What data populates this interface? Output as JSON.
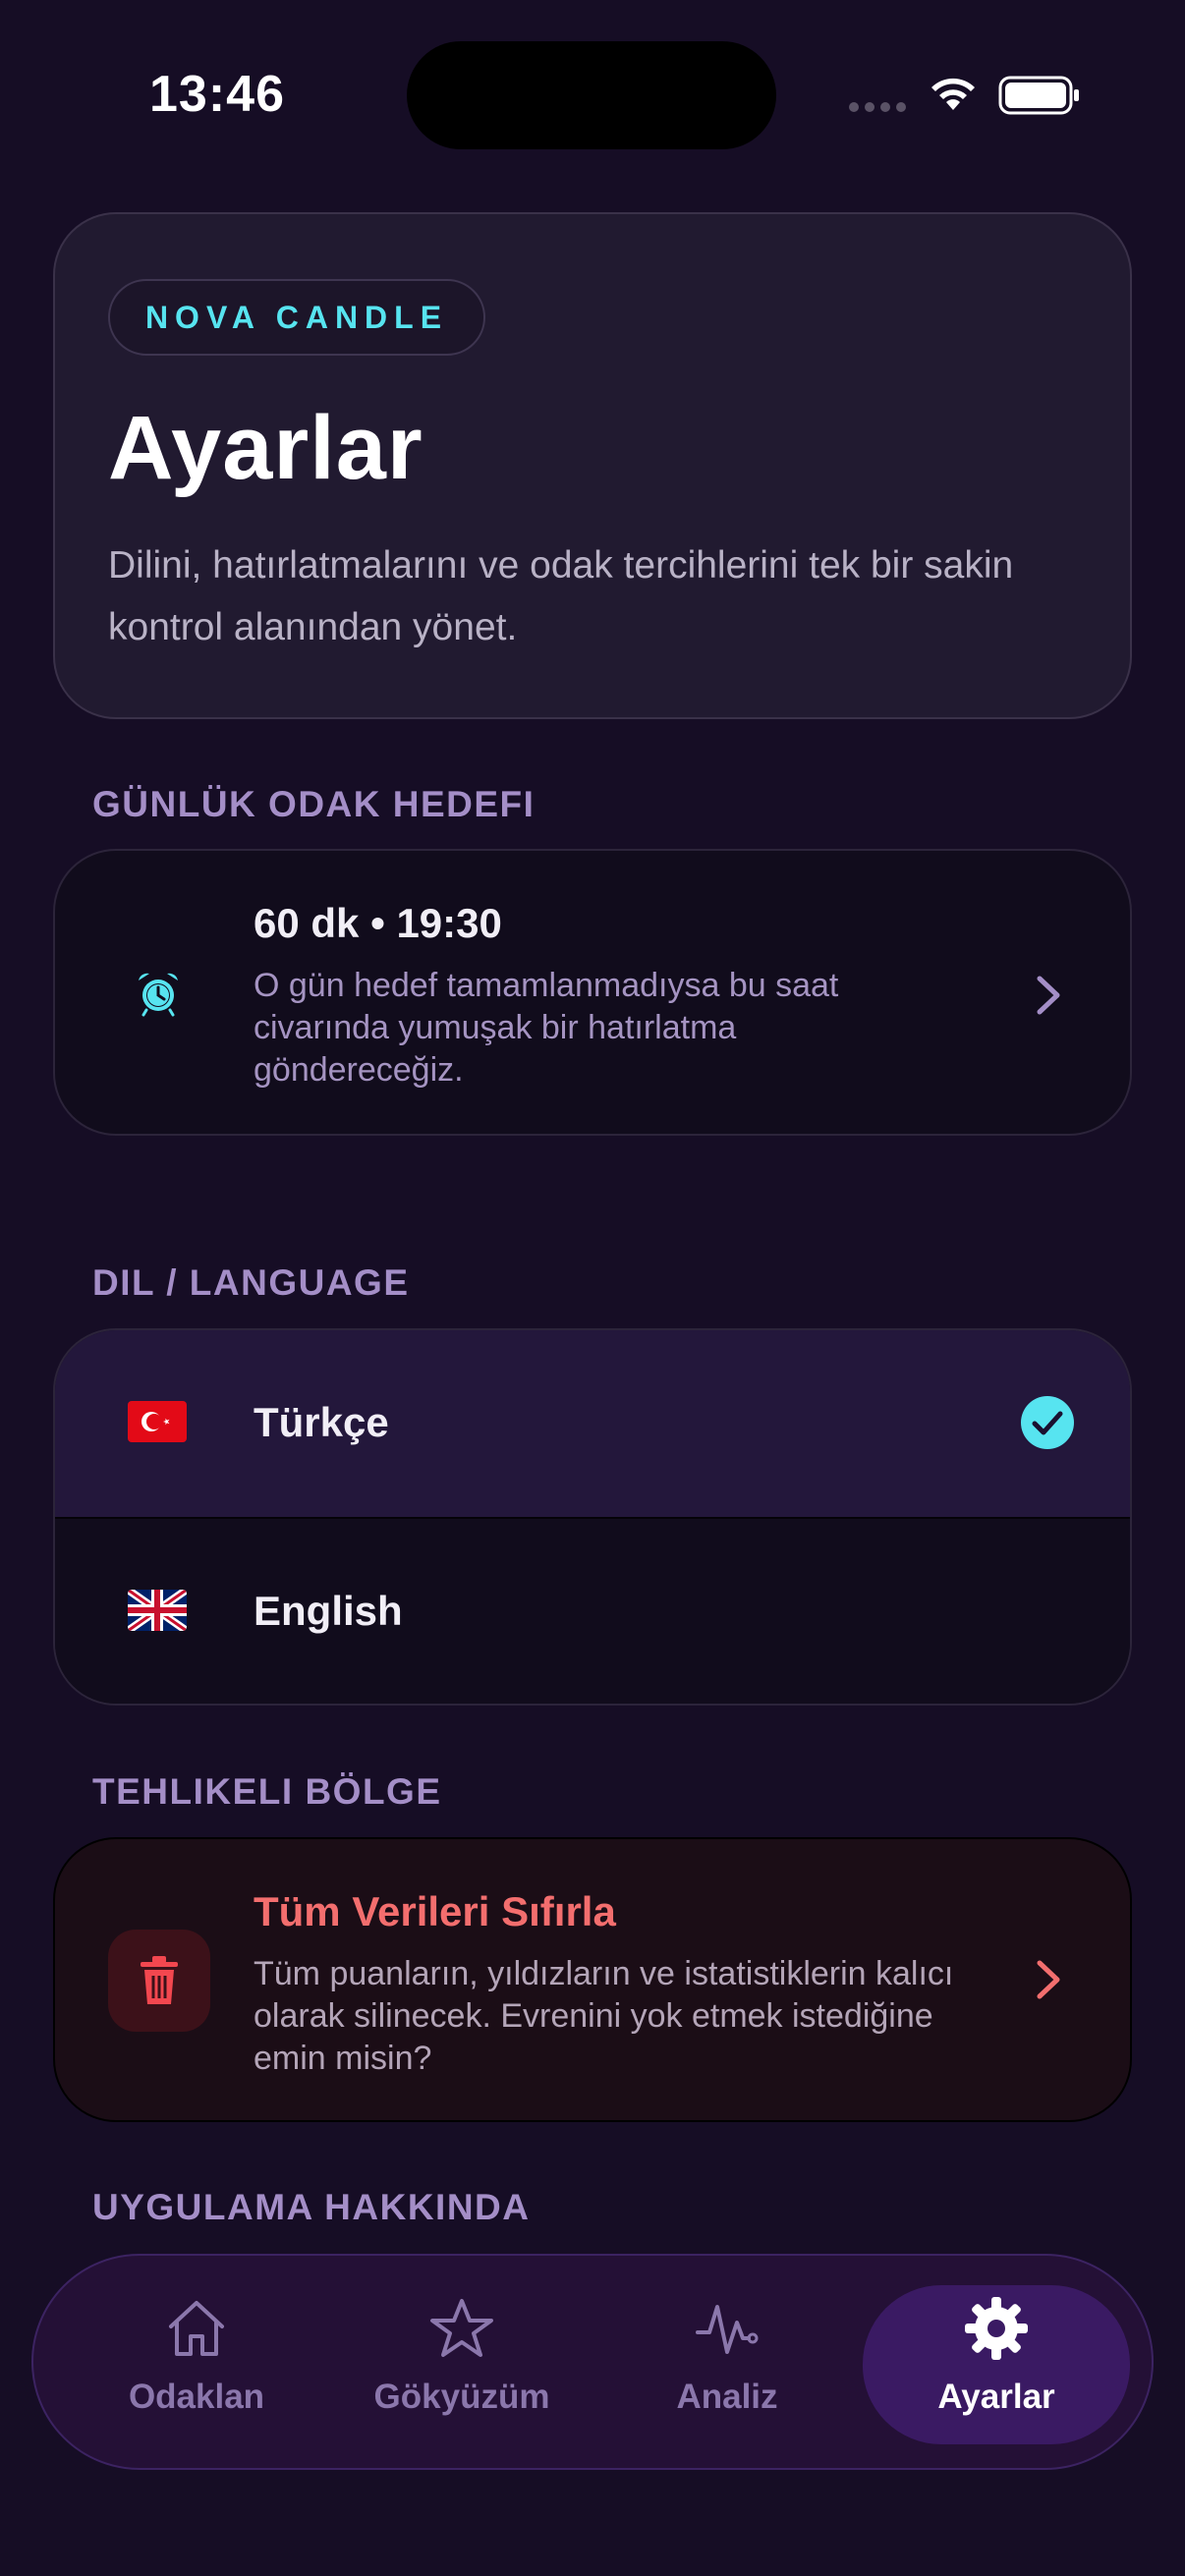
{
  "status_bar": {
    "time": "13:46"
  },
  "hero": {
    "brand": "NOVA CANDLE",
    "title": "Ayarlar",
    "description": "Dilini, hatırlatmalarını ve odak tercihlerini tek bir sakin kontrol alanından yönet."
  },
  "goal_section": {
    "label": "GÜNLÜK ODAK HEDEFI",
    "title": "60 dk • 19:30",
    "description": "O gün hedef tamamlanmadıysa bu saat civarında yumuşak bir hatırlatma göndereceğiz.",
    "icon": "alarm-clock-icon"
  },
  "language_section": {
    "label": "DIL / LANGUAGE",
    "options": [
      {
        "label": "Türkçe",
        "flag": "turkey-flag-icon",
        "selected": true
      },
      {
        "label": "English",
        "flag": "uk-flag-icon",
        "selected": false
      }
    ]
  },
  "danger_section": {
    "label": "TEHLIKELI BÖLGE",
    "title": "Tüm Verileri Sıfırla",
    "description": "Tüm puanların, yıldızların ve istatistiklerin kalıcı olarak silinecek. Evrenini yok etmek istediğine emin misin?",
    "icon": "trash-icon"
  },
  "about_section": {
    "label": "UYGULAMA HAKKINDA"
  },
  "nav": {
    "items": [
      {
        "label": "Odaklan",
        "icon": "home-icon",
        "active": false
      },
      {
        "label": "Gökyüzüm",
        "icon": "star-icon",
        "active": false
      },
      {
        "label": "Analiz",
        "icon": "pulse-icon",
        "active": false
      },
      {
        "label": "Ayarlar",
        "icon": "gear-icon",
        "active": true
      }
    ]
  },
  "colors": {
    "background": "#160d25",
    "accent_cyan": "#57e4f0",
    "section_label": "#a48ec7",
    "danger": "#f36e6e",
    "nav_active": "#3a1a63"
  }
}
